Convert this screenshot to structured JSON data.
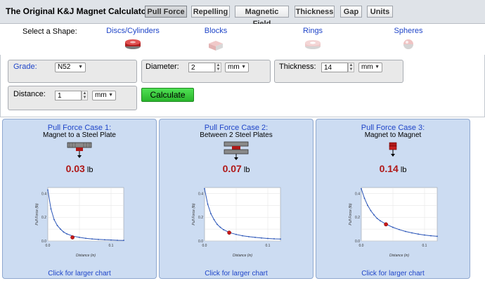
{
  "header": {
    "title": "The Original K&J Magnet Calculator",
    "tabs": [
      "Pull Force",
      "Repelling",
      "Magnetic Field",
      "Thickness",
      "Gap",
      "Units"
    ],
    "active_tab": "Pull Force"
  },
  "shapes": {
    "prompt": "Select a Shape:",
    "items": [
      {
        "label": "Discs/Cylinders",
        "icon": "disc-magnet-icon",
        "selected": true
      },
      {
        "label": "Blocks",
        "icon": "block-magnet-icon",
        "selected": false
      },
      {
        "label": "Rings",
        "icon": "ring-magnet-icon",
        "selected": false
      },
      {
        "label": "Spheres",
        "icon": "sphere-magnet-icon",
        "selected": false
      }
    ]
  },
  "inputs": {
    "grade": {
      "label": "Grade:",
      "value": "N52"
    },
    "diameter": {
      "label": "Diameter:",
      "value": "2",
      "unit": "mm"
    },
    "thickness": {
      "label": "Thickness:",
      "value": "14",
      "unit": "mm"
    },
    "distance": {
      "label": "Distance:",
      "value": "1",
      "unit": "mm"
    },
    "calculate_label": "Calculate"
  },
  "cases": [
    {
      "title": "Pull Force Case 1:",
      "subtitle": "Magnet to a Steel Plate",
      "value": "0.03",
      "unit": "lb",
      "link": "Click for larger chart",
      "icon": "magnet-to-plate-icon"
    },
    {
      "title": "Pull Force Case 2:",
      "subtitle": "Between 2 Steel Plates",
      "value": "0.07",
      "unit": "lb",
      "link": "Click for larger chart",
      "icon": "magnet-between-plates-icon"
    },
    {
      "title": "Pull Force Case 3:",
      "subtitle": "Magnet to Magnet",
      "value": "0.14",
      "unit": "lb",
      "link": "Click for larger chart",
      "icon": "magnet-to-magnet-icon"
    }
  ],
  "colors": {
    "accent_blue": "#1f45c8",
    "force_red": "#b01818",
    "panel_blue": "#ccdcf2",
    "curve": "#2a55b8",
    "marker": "#c81818"
  },
  "chart_data": [
    {
      "type": "line",
      "xlabel": "Distance (in)",
      "ylabel": "Pull Force (lb)",
      "xlim": [
        0,
        0.12
      ],
      "ylim": [
        0,
        0.45
      ],
      "xticks": [
        "0.0",
        "0.1"
      ],
      "yticks": [
        "0.0",
        "0.2",
        "0.4"
      ],
      "grid": true,
      "x": [
        0,
        0.005,
        0.01,
        0.015,
        0.02,
        0.025,
        0.03,
        0.04,
        0.05,
        0.06,
        0.07,
        0.08,
        0.09,
        0.1,
        0.11,
        0.12
      ],
      "values": [
        0.43,
        0.27,
        0.18,
        0.13,
        0.1,
        0.075,
        0.06,
        0.04,
        0.03,
        0.022,
        0.017,
        0.013,
        0.01,
        0.008,
        0.006,
        0.005
      ],
      "highlight": {
        "x": 0.039,
        "y": 0.03
      }
    },
    {
      "type": "line",
      "xlabel": "Distance (in)",
      "ylabel": "Pull Force (lb)",
      "xlim": [
        0,
        0.12
      ],
      "ylim": [
        0,
        0.45
      ],
      "xticks": [
        "0.0",
        "0.1"
      ],
      "yticks": [
        "0.0",
        "0.2",
        "0.4"
      ],
      "grid": true,
      "x": [
        0,
        0.005,
        0.01,
        0.015,
        0.02,
        0.025,
        0.03,
        0.04,
        0.05,
        0.06,
        0.07,
        0.08,
        0.09,
        0.1,
        0.11,
        0.12
      ],
      "values": [
        0.44,
        0.31,
        0.23,
        0.18,
        0.14,
        0.115,
        0.095,
        0.07,
        0.055,
        0.044,
        0.036,
        0.03,
        0.025,
        0.021,
        0.018,
        0.016
      ],
      "highlight": {
        "x": 0.039,
        "y": 0.07
      }
    },
    {
      "type": "line",
      "xlabel": "Distance (in)",
      "ylabel": "Pull Force (lb)",
      "xlim": [
        0,
        0.12
      ],
      "ylim": [
        0,
        0.45
      ],
      "xticks": [
        "0.0",
        "0.1"
      ],
      "yticks": [
        "0.0",
        "0.2",
        "0.4"
      ],
      "grid": true,
      "x": [
        0,
        0.005,
        0.01,
        0.015,
        0.02,
        0.025,
        0.03,
        0.04,
        0.05,
        0.06,
        0.07,
        0.08,
        0.09,
        0.1,
        0.11,
        0.12
      ],
      "values": [
        0.44,
        0.36,
        0.3,
        0.255,
        0.22,
        0.19,
        0.17,
        0.14,
        0.115,
        0.096,
        0.08,
        0.068,
        0.058,
        0.05,
        0.044,
        0.039
      ],
      "highlight": {
        "x": 0.039,
        "y": 0.14
      }
    }
  ]
}
